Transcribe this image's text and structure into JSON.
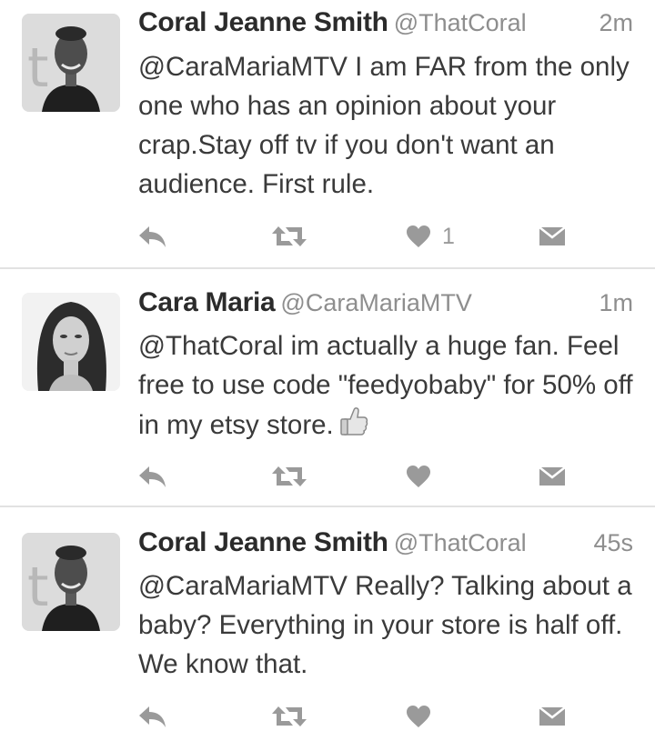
{
  "tweets": [
    {
      "name": "Coral Jeanne Smith",
      "handle": "@ThatCoral",
      "time": "2m",
      "text": "@CaraMariaMTV I am FAR from the only one who has an opinion about your crap.Stay off tv if you don't want an audience. First rule.",
      "like_count": "1",
      "avatar_icon": "profile-photo-coral"
    },
    {
      "name": "Cara Maria",
      "handle": "@CaraMariaMTV",
      "time": "1m",
      "text": "@ThatCoral im actually a huge fan. Feel free to use code \"feedyobaby\" for 50% off in my etsy store.",
      "like_count": "",
      "avatar_icon": "profile-photo-cara",
      "emoji": "thumbs-up-icon"
    },
    {
      "name": "Coral Jeanne Smith",
      "handle": "@ThatCoral",
      "time": "45s",
      "text": "@CaraMariaMTV Really? Talking about a baby? Everything in your store is half off. We know that.",
      "like_count": "",
      "avatar_icon": "profile-photo-coral"
    }
  ],
  "colors": {
    "icon_gray": "#9a9a9a",
    "divider": "#e2e2e2",
    "text": "#3a3a3a",
    "secondary": "#8e8e8e"
  }
}
